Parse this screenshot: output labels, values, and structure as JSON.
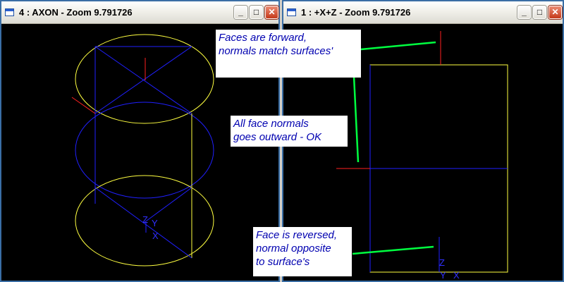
{
  "windows": [
    {
      "title": "4 : AXON - Zoom 9.791726",
      "axis_labels": [
        "Z",
        "Y",
        "X"
      ],
      "buttons": [
        "minimize",
        "maximize",
        "close"
      ]
    },
    {
      "title": "1 : +X+Z - Zoom 9.791726",
      "axis_labels": [
        "Z",
        "Y",
        "X"
      ],
      "buttons": [
        "minimize",
        "maximize",
        "close"
      ]
    }
  ],
  "annotations": {
    "forward": "Faces are forward,\nnormals match surfaces'",
    "outward": "All face normals\ngoes outward - OK",
    "reversed": "Face is reversed,\nnormal opposite\nto surface's"
  },
  "colors": {
    "viewport_bg": "#000000",
    "wire_yellow": "#ffff40",
    "wire_blue": "#2020ff",
    "normal_red": "#ff2020",
    "leader_green": "#00ff40",
    "annotation_text": "#0000b0"
  },
  "icons": [
    "window-icon",
    "minimize-icon",
    "maximize-icon",
    "close-icon"
  ]
}
